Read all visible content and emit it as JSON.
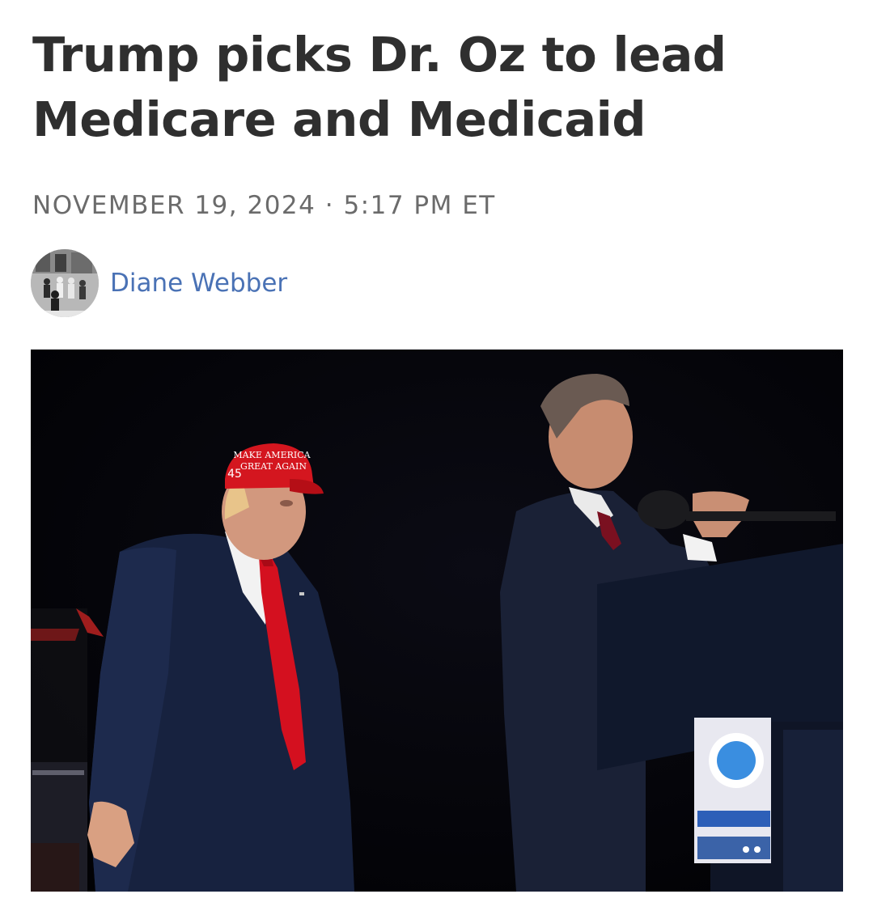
{
  "article": {
    "headline": "Trump picks Dr. Oz to lead Medicare and Medicaid",
    "dateline": "NOVEMBER 19, 2024 · 5:17 PM ET",
    "author": {
      "name": "Diane Webber"
    },
    "photo": {
      "cap_text_line1": "MAKE AMERICA",
      "cap_text_line2": "GREAT AGAIN",
      "cap_side_number": "45"
    }
  },
  "colors": {
    "headline": "#2f2f2f",
    "dateline": "#6b6b6b",
    "author_link": "#4a72b5",
    "photo_background": "#04040a"
  }
}
